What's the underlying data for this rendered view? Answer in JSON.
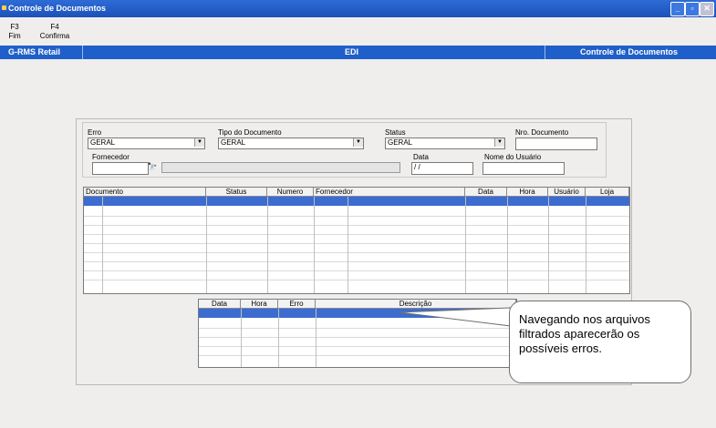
{
  "window": {
    "title": "Controle de Documentos"
  },
  "function_keys": [
    {
      "key": "F3",
      "label": "Fim"
    },
    {
      "key": "F4",
      "label": "Confirma"
    }
  ],
  "menubar": {
    "left": "G-RMS Retail",
    "center": "EDI",
    "right": "Controle de Documentos"
  },
  "filters": {
    "erro_label": "Erro",
    "erro_value": "GERAL",
    "tipo_label": "Tipo do Documento",
    "tipo_value": "GERAL",
    "status_label": "Status",
    "status_value": "GERAL",
    "nro_label": "Nro. Documento",
    "nro_value": "",
    "fornecedor_label": "Fornecedor",
    "fornecedor_value": "",
    "data_label": "Data",
    "data_value": " / /",
    "usuario_label": "Nome do Usuário",
    "usuario_value": ""
  },
  "docs_table": {
    "columns": [
      "Documento",
      "Status",
      "Numero",
      "Fornecedor",
      "Data",
      "Hora",
      "Usuário",
      "Loja"
    ]
  },
  "errors_table": {
    "columns": [
      "Data",
      "Hora",
      "Erro",
      "Descrição"
    ]
  },
  "callout": {
    "text": "Navegando nos arquivos filtrados aparecerão os possíveis erros."
  }
}
